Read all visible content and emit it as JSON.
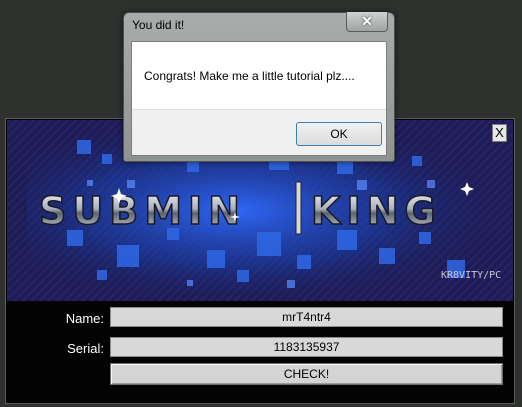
{
  "crackme": {
    "close_label": "X",
    "banner": {
      "logo_left": "SUBMIN",
      "logo_right": "KING",
      "credit": "KR8VITY/PC"
    },
    "name_label": "Name:",
    "name_value": "mrT4ntr4",
    "serial_label": "Serial:",
    "serial_value": "1183135937",
    "check_label": "CHECK!"
  },
  "dialog": {
    "title": "You did it!",
    "close_glyph": "✕",
    "message": "Congrats! Make me a little tutorial plz....",
    "ok_label": "OK"
  },
  "colors": {
    "desktop": "#2e312e",
    "banner_bg": "#1c1a4e",
    "banner_blue": "#2a5cd8",
    "logo_silver": "#c8ccd4"
  }
}
